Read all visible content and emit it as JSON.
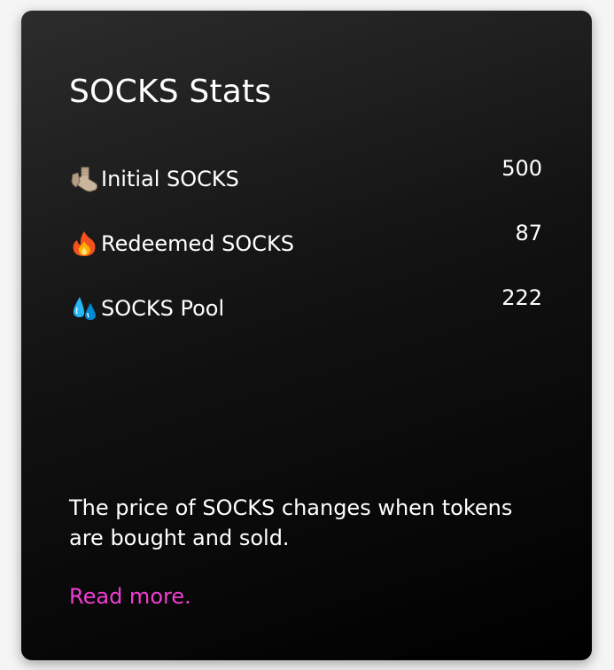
{
  "card": {
    "title": "SOCKS Stats",
    "stats": [
      {
        "icon": "sock-icon",
        "label": "Initial SOCKS",
        "value": "500"
      },
      {
        "icon": "fire-icon",
        "label": "Redeemed SOCKS",
        "value": "87"
      },
      {
        "icon": "droplets-icon",
        "label": "SOCKS Pool",
        "value": "222"
      }
    ],
    "description": "The price of SOCKS changes when tokens are bought and sold.",
    "link_label": "Read more."
  },
  "colors": {
    "link": "#f13dd4",
    "text": "#ffffff",
    "card_top": "#2c2c2c",
    "card_bottom": "#000000"
  }
}
